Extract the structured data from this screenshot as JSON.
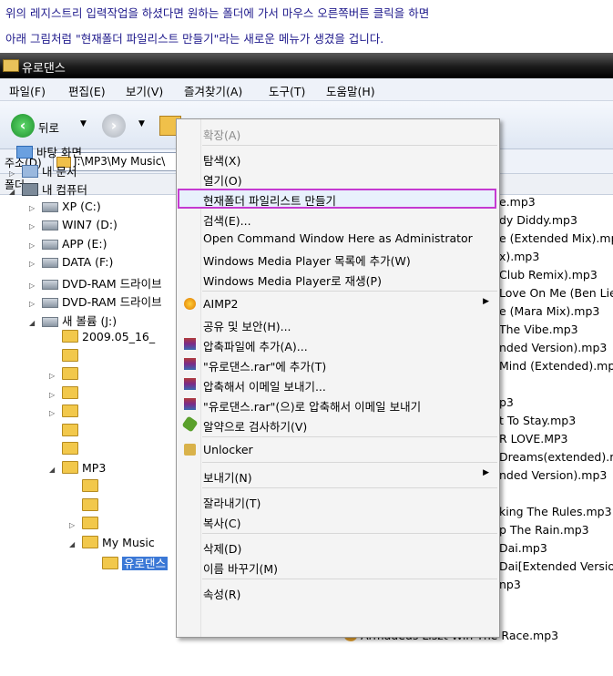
{
  "caption": {
    "line1": "위의 레지스트리 입력작업을 하셨다면 원하는 폴더에 가서 마우스 오른쪽버튼 클릭을 하면",
    "line2": "아래 그림처럼 \"현재폴더 파일리스트 만들기\"라는 새로운 메뉴가 생겼을 겁니다."
  },
  "window": {
    "title": "유로댄스"
  },
  "menubar": [
    "파일(F)",
    "편집(E)",
    "보기(V)",
    "즐겨찾기(A)",
    "도구(T)",
    "도움말(H)"
  ],
  "toolbar": {
    "back_label": "뒤로"
  },
  "address": {
    "label": "주소(D)",
    "path": "J:\\MP3\\My Music\\"
  },
  "folders_label": "폴더",
  "tree": [
    {
      "label": "바탕 화면",
      "icon": "desk",
      "exp": ""
    },
    {
      "label": "내 문서",
      "icon": "doc",
      "exp": "▷"
    },
    {
      "label": "내 컴퓨터",
      "icon": "pc",
      "exp": "◢"
    },
    {
      "label": "XP (C:)",
      "icon": "drive",
      "exp": "▷"
    },
    {
      "label": "WIN7 (D:)",
      "icon": "drive",
      "exp": "▷"
    },
    {
      "label": "APP (E:)",
      "icon": "drive",
      "exp": "▷"
    },
    {
      "label": "DATA (F:)",
      "icon": "drive",
      "exp": "▷"
    },
    {
      "label": "DVD-RAM 드라이브",
      "icon": "drive",
      "exp": "▷"
    },
    {
      "label": "DVD-RAM 드라이브",
      "icon": "drive",
      "exp": "▷"
    },
    {
      "label": "새 볼륨 (J:)",
      "icon": "drive",
      "exp": "◢"
    },
    {
      "label": "2009.05_16_",
      "icon": "folder",
      "exp": ""
    },
    {
      "label": "",
      "icon": "folder",
      "exp": ""
    },
    {
      "label": "",
      "icon": "folder",
      "exp": "▷"
    },
    {
      "label": "",
      "icon": "folder",
      "exp": "▷"
    },
    {
      "label": "",
      "icon": "folder",
      "exp": "▷"
    },
    {
      "label": "",
      "icon": "folder",
      "exp": ""
    },
    {
      "label": "",
      "icon": "folder",
      "exp": ""
    },
    {
      "label": "MP3",
      "icon": "folder",
      "exp": "◢"
    },
    {
      "label": "",
      "icon": "folder",
      "exp": ""
    },
    {
      "label": "",
      "icon": "folder",
      "exp": ""
    },
    {
      "label": "",
      "icon": "folder",
      "exp": "▷"
    },
    {
      "label": "My Music",
      "icon": "folder",
      "exp": "◢"
    },
    {
      "label": "유로댄스",
      "icon": "folder",
      "exp": "",
      "selected": true
    }
  ],
  "files": [
    "e.mp3",
    "dy Diddy.mp3",
    "e (Extended Mix).mp",
    "x).mp3",
    "Club Remix).mp3",
    "Love On Me (Ben Lie",
    "e (Mara Mix).mp3",
    "The Vibe.mp3",
    "nded Version).mp3",
    "Mind (Extended).mp",
    "",
    "p3",
    "t To Stay.mp3",
    "R LOVE.MP3",
    "Dreams(extended).m",
    "nded Version).mp3",
    "",
    "king The Rules.mp3",
    "p The Rain.mp3",
    "Dai.mp3",
    "Dai[Extended Version]",
    "np3",
    "np3",
    "Race.mp3"
  ],
  "bottom_file": "Armadeus Liszt-Win The Race.mp3",
  "context_menu": [
    {
      "label": "확장(A)",
      "disabled": true
    },
    {
      "sep": true
    },
    {
      "label": "탐색(X)"
    },
    {
      "label": "열기(O)"
    },
    {
      "label": "현재폴더 파일리스트 만들기",
      "highlight": true
    },
    {
      "label": "검색(E)..."
    },
    {
      "label": "Open Command Window Here as Administrator"
    },
    {
      "label": "Windows Media Player 목록에 추가(W)"
    },
    {
      "label": "Windows Media Player로 재생(P)"
    },
    {
      "sep": true
    },
    {
      "label": "AIMP2",
      "icon": "aimp",
      "submenu": true
    },
    {
      "label": "공유 및 보안(H)..."
    },
    {
      "label": "압축파일에 추가(A)...",
      "icon": "rar"
    },
    {
      "label": "\"유로댄스.rar\"에 추가(T)",
      "icon": "rar"
    },
    {
      "label": "압축해서 이메일 보내기...",
      "icon": "rar"
    },
    {
      "label": "\"유로댄스.rar\"(으)로 압축해서 이메일 보내기",
      "icon": "rar"
    },
    {
      "label": "알약으로 검사하기(V)",
      "icon": "alyac"
    },
    {
      "sep": true
    },
    {
      "label": "Unlocker",
      "icon": "unlocker"
    },
    {
      "sep": true
    },
    {
      "label": "보내기(N)",
      "submenu": true
    },
    {
      "sep": true
    },
    {
      "label": "잘라내기(T)"
    },
    {
      "label": "복사(C)"
    },
    {
      "sep": true
    },
    {
      "label": "삭제(D)"
    },
    {
      "label": "이름 바꾸기(M)"
    },
    {
      "sep": true
    },
    {
      "label": "속성(R)"
    }
  ],
  "colors": {
    "caption": "#1f1a8c",
    "highlight_border": "#c53ad1",
    "selection": "#3b78d6"
  }
}
